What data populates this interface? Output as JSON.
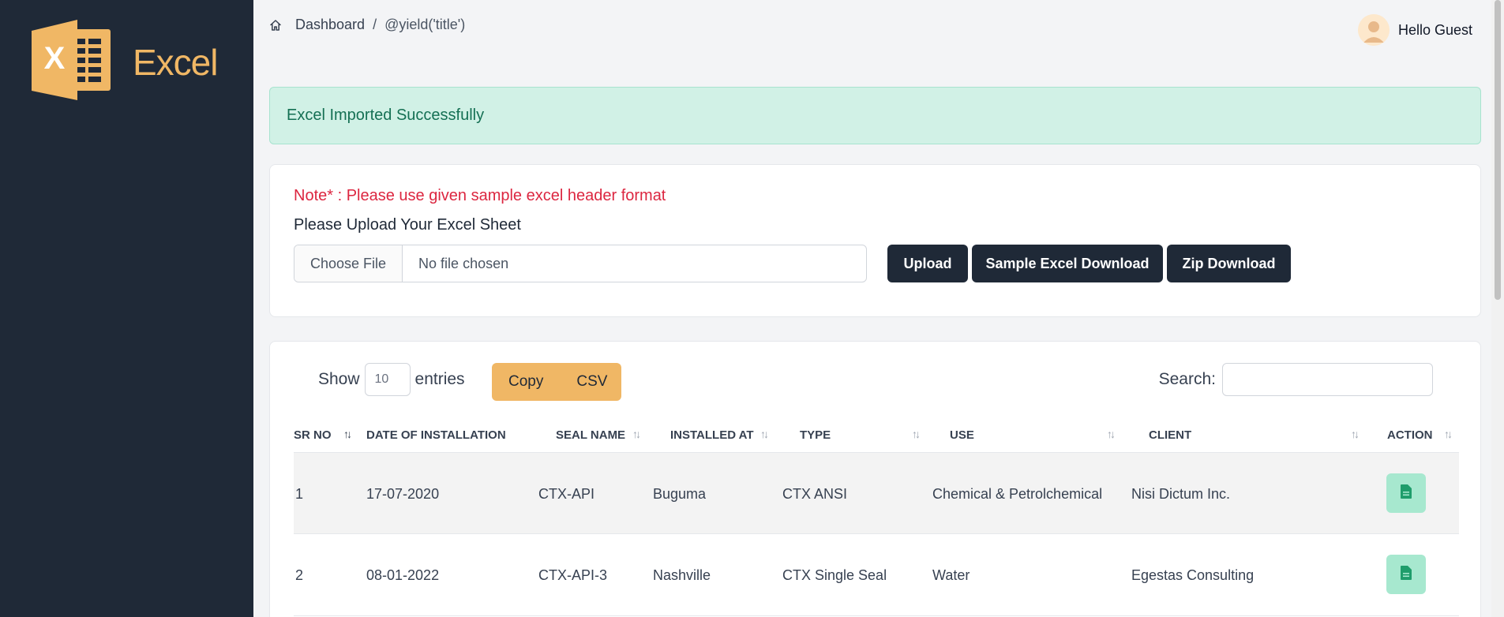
{
  "app": {
    "logo_text": "Excel",
    "logo_icon": "excel-logo-icon"
  },
  "breadcrumb": {
    "home_icon": "home-icon",
    "dashboard": "Dashboard",
    "separator": "/",
    "current": "@yield('title')"
  },
  "user": {
    "greeting": "Hello Guest",
    "avatar_icon": "avatar-icon"
  },
  "alert": {
    "message": "Excel Imported Successfully"
  },
  "upload": {
    "note": "Note* : Please use given sample excel header format",
    "label": "Please Upload Your Excel Sheet",
    "choose_file": "Choose File",
    "no_file": "No file chosen",
    "upload_button": "Upload",
    "sample_button": "Sample Excel Download",
    "zip_button": "Zip Download"
  },
  "table": {
    "show_label": "Show",
    "entries_value": "10",
    "entries_label": "entries",
    "copy_label": "Copy",
    "csv_label": "CSV",
    "search_label": "Search:",
    "search_value": "",
    "columns": [
      "SR NO",
      "DATE OF INSTALLATION",
      "SEAL NAME",
      "INSTALLED AT",
      "TYPE",
      "USE",
      "CLIENT",
      "ACTION"
    ],
    "sorted_column": "SR NO",
    "sort_direction": "ascending",
    "rows": [
      {
        "sr": "1",
        "date": "17-07-2020",
        "seal": "CTX-API",
        "installed_at": "Buguma",
        "type": "CTX ANSI",
        "use": "Chemical & Petrolchemical",
        "client": "Nisi Dictum Inc.",
        "action_icon": "document-icon"
      },
      {
        "sr": "2",
        "date": "08-01-2022",
        "seal": "CTX-API-3",
        "installed_at": "Nashville",
        "type": "CTX Single Seal",
        "use": "Water",
        "client": "Egestas Consulting",
        "action_icon": "document-icon"
      }
    ]
  },
  "colors": {
    "sidebar": "#1f2937",
    "accent": "#f0b765",
    "success_bg": "#d1f1e6",
    "success_text": "#157054",
    "note_red": "#dc2640",
    "action_green": "#a7e8cf"
  }
}
